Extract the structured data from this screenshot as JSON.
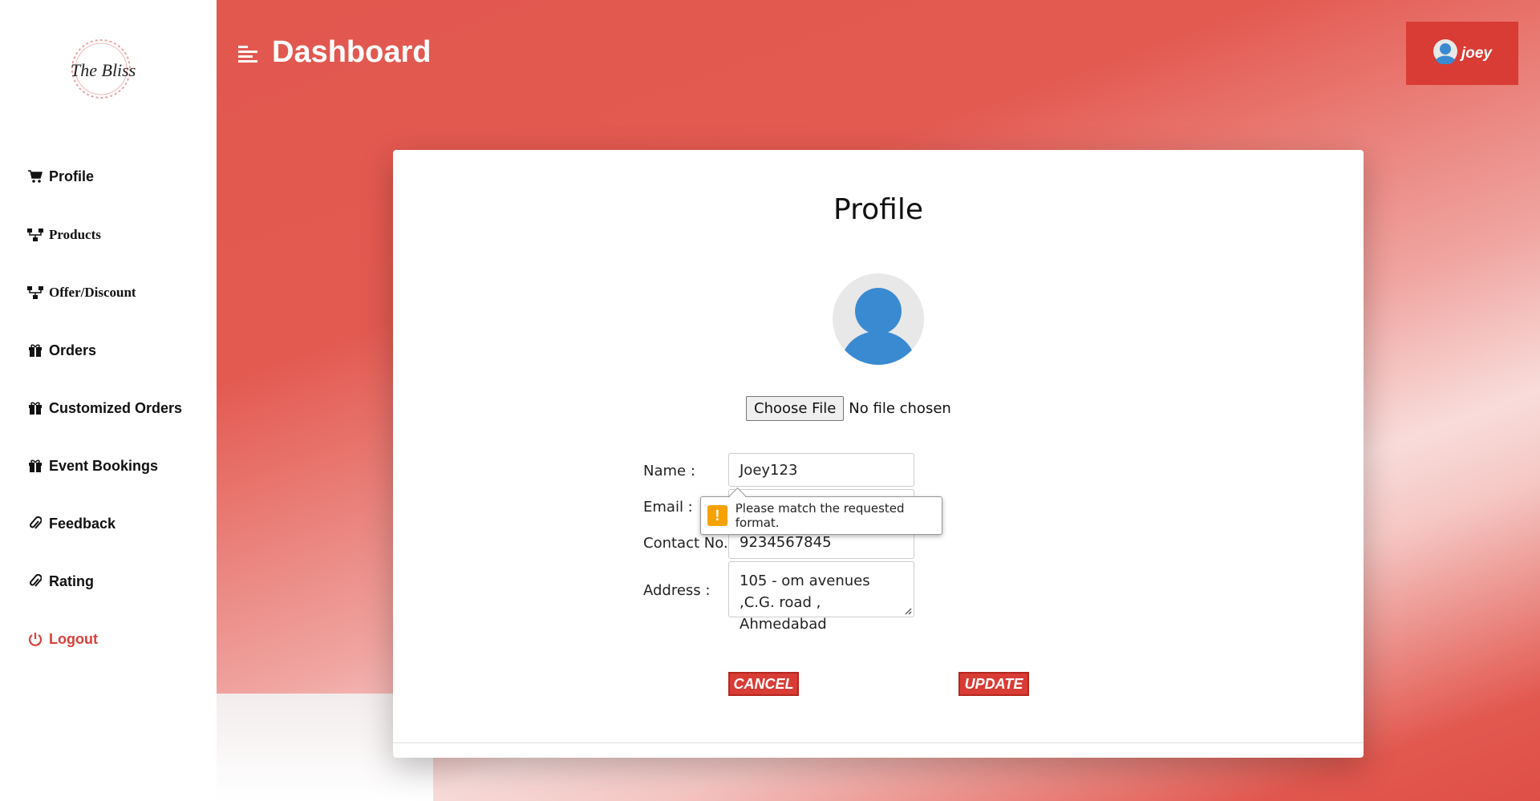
{
  "header": {
    "title": "Dashboard",
    "user_name": "joey"
  },
  "sidebar": {
    "logo_text": "The Bliss",
    "items": [
      {
        "label": "Profile",
        "icon": "cart-icon"
      },
      {
        "label": "Products",
        "icon": "sitemap-icon"
      },
      {
        "label": "Offer/Discount",
        "icon": "sitemap-icon"
      },
      {
        "label": "Orders",
        "icon": "gift-icon"
      },
      {
        "label": "Customized Orders",
        "icon": "gift-icon"
      },
      {
        "label": "Event Bookings",
        "icon": "gift-icon"
      },
      {
        "label": "Feedback",
        "icon": "paperclip-icon"
      },
      {
        "label": "Rating",
        "icon": "paperclip-icon"
      },
      {
        "label": "Logout",
        "icon": "power-icon"
      }
    ]
  },
  "profile": {
    "title": "Profile",
    "file_button": "Choose File",
    "file_status": "No file chosen",
    "name_label": "Name :",
    "name_value": "Joey123",
    "email_label": "Email :",
    "email_value": "",
    "contact_label": "Contact No. :",
    "contact_value": "9234567845",
    "address_label": "Address :",
    "address_value": "105 - om avenues ,C.G. road , Ahmedabad",
    "validation_message": "Please match the requested format.",
    "cancel_label": "CANCEL",
    "update_label": "UPDATE"
  },
  "colors": {
    "accent": "#d83c35",
    "avatar_blue": "#3a8ad1",
    "warning": "#f5a200"
  }
}
